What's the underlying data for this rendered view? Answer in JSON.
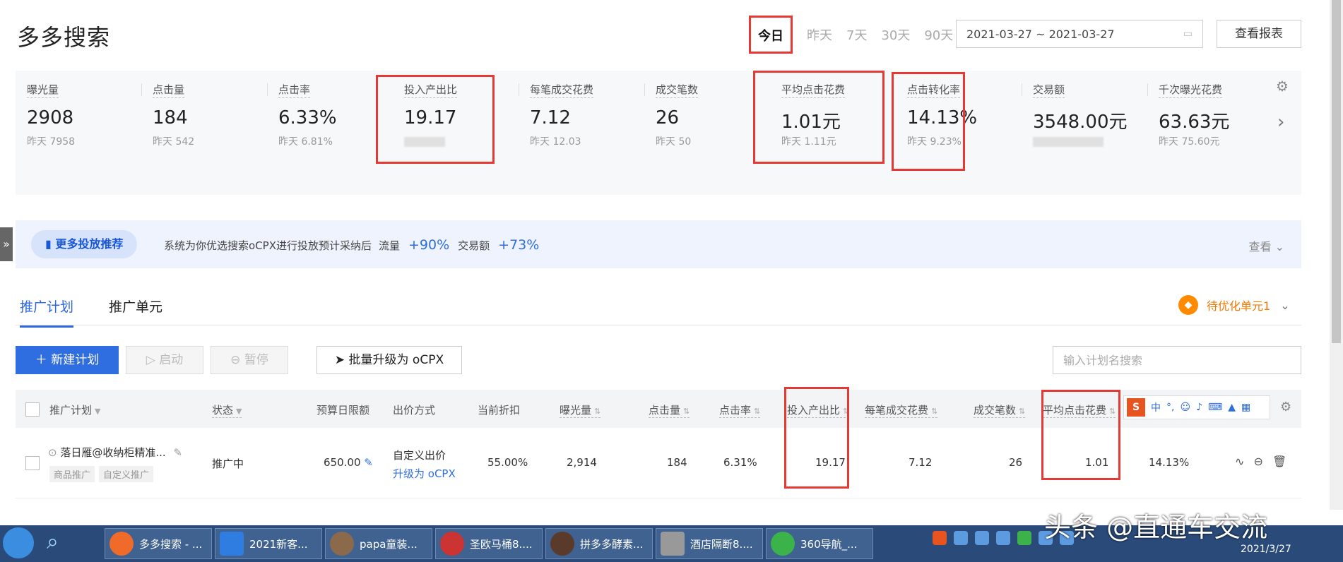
{
  "page": {
    "title": "多多搜索"
  },
  "range_tabs": [
    "今日",
    "昨天",
    "7天",
    "30天",
    "90天"
  ],
  "active_range": "今日",
  "date_range": "2021-03-27 ~ 2021-03-27",
  "report_button": "查看报表",
  "metrics": [
    {
      "label": "曝光量",
      "value": "2908",
      "prev": "昨天 7958"
    },
    {
      "label": "点击量",
      "value": "184",
      "prev": "昨天 542"
    },
    {
      "label": "点击率",
      "value": "6.33%",
      "prev": "昨天 6.81%"
    },
    {
      "label": "投入产出比",
      "value": "19.17",
      "prev": ""
    },
    {
      "label": "每笔成交花费",
      "value": "7.12",
      "prev": "昨天 12.03"
    },
    {
      "label": "成交笔数",
      "value": "26",
      "prev": "昨天 50"
    },
    {
      "label": "平均点击花费",
      "value": "1.01元",
      "prev": "昨天 1.11元"
    },
    {
      "label": "点击转化率",
      "value": "14.13%",
      "prev": "昨天 9.23%"
    },
    {
      "label": "交易额",
      "value": "3548.00元",
      "prev": ""
    },
    {
      "label": "千次曝光花费",
      "value": "63.63元",
      "prev": "昨天 75.60元"
    }
  ],
  "banner": {
    "button": "更多投放推荐",
    "text": "系统为你优选搜索oCPX进行投放预计采纳后",
    "flow_label": "流量",
    "flow_value": "+90%",
    "gmv_label": "交易额",
    "gmv_value": "+73%",
    "view": "查看"
  },
  "tabs": [
    "推广计划",
    "推广单元"
  ],
  "pending": "待优化单元1",
  "toolbar": {
    "new_plan": "新建计划",
    "start": "启动",
    "pause": "暂停",
    "upgrade": "批量升级为 oCPX",
    "search_placeholder": "输入计划名搜索"
  },
  "table": {
    "headers": [
      "推广计划",
      "状态",
      "预算日限额",
      "出价方式",
      "当前折扣",
      "曝光量",
      "点击量",
      "点击率",
      "投入产出比",
      "每笔成交花费",
      "成交笔数",
      "平均点击花费"
    ],
    "rows": [
      {
        "name": "落日雁@收纳柜精准...",
        "tags": [
          "商品推广",
          "自定义推广"
        ],
        "status": "推广中",
        "budget": "650.00",
        "bid_method": "自定义出价",
        "bid_upgrade": "升级为 oCPX",
        "discount": "55.00%",
        "impressions": "2,914",
        "clicks": "184",
        "ctr": "6.31%",
        "roi": "19.17",
        "cost_per_order": "7.12",
        "orders": "26",
        "avg_cpc": "1.01",
        "cvr": "14.13%"
      }
    ]
  },
  "ime_toolbar": [
    "中",
    "°,"
  ],
  "taskbar": {
    "items": [
      "多多搜索 - ...",
      "2021新客...",
      "papa童装...",
      "圣欧马桶8....",
      "拼多多酵素...",
      "酒店隔断8....",
      "360导航_..."
    ],
    "date": "2021/3/27",
    "watermark": "头条 @直通车交流"
  }
}
